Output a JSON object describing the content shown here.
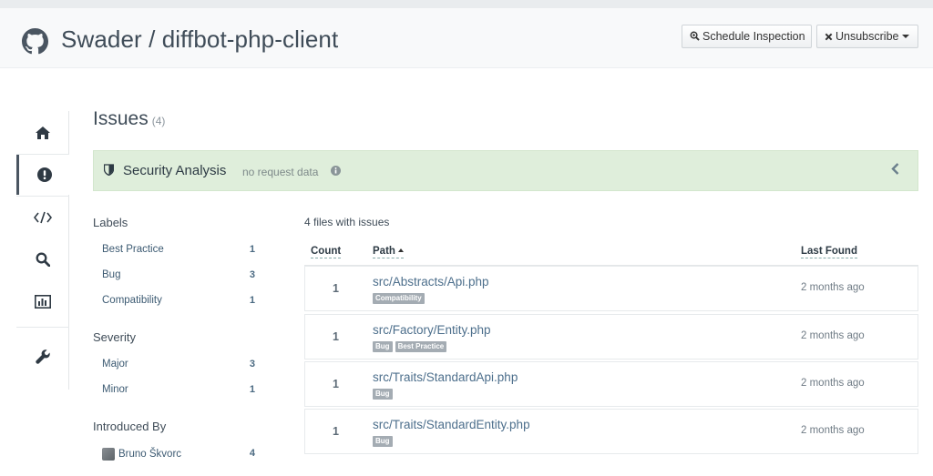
{
  "header": {
    "repo_title": "Swader / diffbot-php-client",
    "schedule_label": "Schedule Inspection",
    "unsubscribe_label": "Unsubscribe"
  },
  "sidenav": {
    "items": [
      {
        "name": "home",
        "icon": "home-icon"
      },
      {
        "name": "issues",
        "icon": "exclamation-circle-icon",
        "active": true
      },
      {
        "name": "code",
        "icon": "code-icon"
      },
      {
        "name": "search",
        "icon": "search-icon"
      },
      {
        "name": "statistics",
        "icon": "bar-chart-icon"
      },
      {
        "name": "settings",
        "icon": "wrench-icon"
      }
    ]
  },
  "page": {
    "title": "Issues",
    "count": "(4)"
  },
  "security": {
    "title": "Security Analysis",
    "subtitle": "no request data",
    "bg_color": "#dfeedb"
  },
  "filters": {
    "labels": {
      "heading": "Labels",
      "items": [
        {
          "label": "Best Practice",
          "count": "1"
        },
        {
          "label": "Bug",
          "count": "3"
        },
        {
          "label": "Compatibility",
          "count": "1"
        }
      ]
    },
    "severity": {
      "heading": "Severity",
      "items": [
        {
          "label": "Major",
          "count": "3"
        },
        {
          "label": "Minor",
          "count": "1"
        }
      ]
    },
    "introduced_by": {
      "heading": "Introduced By",
      "items": [
        {
          "label": "Bruno Škvorc",
          "count": "4"
        }
      ]
    }
  },
  "files": {
    "summary": "4 files with issues",
    "columns": {
      "count": "Count",
      "path": "Path",
      "last_found": "Last Found"
    },
    "rows": [
      {
        "count": "1",
        "path": "src/Abstracts/Api.php",
        "tags": [
          "Compatibility"
        ],
        "last_found": "2 months ago"
      },
      {
        "count": "1",
        "path": "src/Factory/Entity.php",
        "tags": [
          "Bug",
          "Best Practice"
        ],
        "last_found": "2 months ago"
      },
      {
        "count": "1",
        "path": "src/Traits/StandardApi.php",
        "tags": [
          "Bug"
        ],
        "last_found": "2 months ago"
      },
      {
        "count": "1",
        "path": "src/Traits/StandardEntity.php",
        "tags": [
          "Bug"
        ],
        "last_found": "2 months ago"
      }
    ]
  }
}
